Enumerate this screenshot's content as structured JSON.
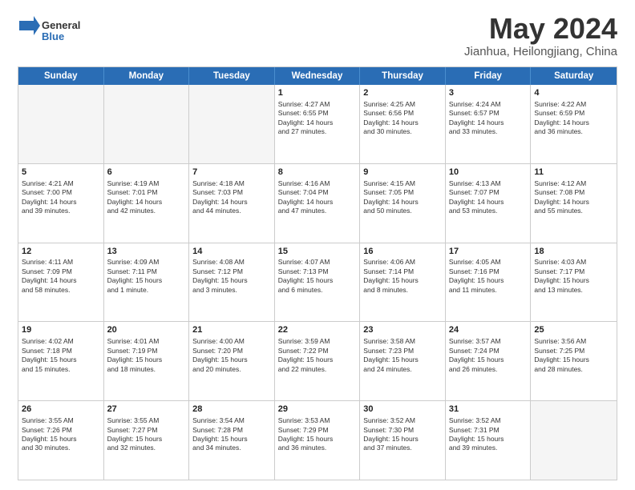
{
  "header": {
    "logo_general": "General",
    "logo_blue": "Blue",
    "month_title": "May 2024",
    "location": "Jianhua, Heilongjiang, China"
  },
  "weekdays": [
    "Sunday",
    "Monday",
    "Tuesday",
    "Wednesday",
    "Thursday",
    "Friday",
    "Saturday"
  ],
  "rows": [
    [
      {
        "day": "",
        "info": "",
        "empty": true
      },
      {
        "day": "",
        "info": "",
        "empty": true
      },
      {
        "day": "",
        "info": "",
        "empty": true
      },
      {
        "day": "1",
        "info": "Sunrise: 4:27 AM\nSunset: 6:55 PM\nDaylight: 14 hours\nand 27 minutes."
      },
      {
        "day": "2",
        "info": "Sunrise: 4:25 AM\nSunset: 6:56 PM\nDaylight: 14 hours\nand 30 minutes."
      },
      {
        "day": "3",
        "info": "Sunrise: 4:24 AM\nSunset: 6:57 PM\nDaylight: 14 hours\nand 33 minutes."
      },
      {
        "day": "4",
        "info": "Sunrise: 4:22 AM\nSunset: 6:59 PM\nDaylight: 14 hours\nand 36 minutes."
      }
    ],
    [
      {
        "day": "5",
        "info": "Sunrise: 4:21 AM\nSunset: 7:00 PM\nDaylight: 14 hours\nand 39 minutes."
      },
      {
        "day": "6",
        "info": "Sunrise: 4:19 AM\nSunset: 7:01 PM\nDaylight: 14 hours\nand 42 minutes."
      },
      {
        "day": "7",
        "info": "Sunrise: 4:18 AM\nSunset: 7:03 PM\nDaylight: 14 hours\nand 44 minutes."
      },
      {
        "day": "8",
        "info": "Sunrise: 4:16 AM\nSunset: 7:04 PM\nDaylight: 14 hours\nand 47 minutes."
      },
      {
        "day": "9",
        "info": "Sunrise: 4:15 AM\nSunset: 7:05 PM\nDaylight: 14 hours\nand 50 minutes."
      },
      {
        "day": "10",
        "info": "Sunrise: 4:13 AM\nSunset: 7:07 PM\nDaylight: 14 hours\nand 53 minutes."
      },
      {
        "day": "11",
        "info": "Sunrise: 4:12 AM\nSunset: 7:08 PM\nDaylight: 14 hours\nand 55 minutes."
      }
    ],
    [
      {
        "day": "12",
        "info": "Sunrise: 4:11 AM\nSunset: 7:09 PM\nDaylight: 14 hours\nand 58 minutes."
      },
      {
        "day": "13",
        "info": "Sunrise: 4:09 AM\nSunset: 7:11 PM\nDaylight: 15 hours\nand 1 minute."
      },
      {
        "day": "14",
        "info": "Sunrise: 4:08 AM\nSunset: 7:12 PM\nDaylight: 15 hours\nand 3 minutes."
      },
      {
        "day": "15",
        "info": "Sunrise: 4:07 AM\nSunset: 7:13 PM\nDaylight: 15 hours\nand 6 minutes."
      },
      {
        "day": "16",
        "info": "Sunrise: 4:06 AM\nSunset: 7:14 PM\nDaylight: 15 hours\nand 8 minutes."
      },
      {
        "day": "17",
        "info": "Sunrise: 4:05 AM\nSunset: 7:16 PM\nDaylight: 15 hours\nand 11 minutes."
      },
      {
        "day": "18",
        "info": "Sunrise: 4:03 AM\nSunset: 7:17 PM\nDaylight: 15 hours\nand 13 minutes."
      }
    ],
    [
      {
        "day": "19",
        "info": "Sunrise: 4:02 AM\nSunset: 7:18 PM\nDaylight: 15 hours\nand 15 minutes."
      },
      {
        "day": "20",
        "info": "Sunrise: 4:01 AM\nSunset: 7:19 PM\nDaylight: 15 hours\nand 18 minutes."
      },
      {
        "day": "21",
        "info": "Sunrise: 4:00 AM\nSunset: 7:20 PM\nDaylight: 15 hours\nand 20 minutes."
      },
      {
        "day": "22",
        "info": "Sunrise: 3:59 AM\nSunset: 7:22 PM\nDaylight: 15 hours\nand 22 minutes."
      },
      {
        "day": "23",
        "info": "Sunrise: 3:58 AM\nSunset: 7:23 PM\nDaylight: 15 hours\nand 24 minutes."
      },
      {
        "day": "24",
        "info": "Sunrise: 3:57 AM\nSunset: 7:24 PM\nDaylight: 15 hours\nand 26 minutes."
      },
      {
        "day": "25",
        "info": "Sunrise: 3:56 AM\nSunset: 7:25 PM\nDaylight: 15 hours\nand 28 minutes."
      }
    ],
    [
      {
        "day": "26",
        "info": "Sunrise: 3:55 AM\nSunset: 7:26 PM\nDaylight: 15 hours\nand 30 minutes."
      },
      {
        "day": "27",
        "info": "Sunrise: 3:55 AM\nSunset: 7:27 PM\nDaylight: 15 hours\nand 32 minutes."
      },
      {
        "day": "28",
        "info": "Sunrise: 3:54 AM\nSunset: 7:28 PM\nDaylight: 15 hours\nand 34 minutes."
      },
      {
        "day": "29",
        "info": "Sunrise: 3:53 AM\nSunset: 7:29 PM\nDaylight: 15 hours\nand 36 minutes."
      },
      {
        "day": "30",
        "info": "Sunrise: 3:52 AM\nSunset: 7:30 PM\nDaylight: 15 hours\nand 37 minutes."
      },
      {
        "day": "31",
        "info": "Sunrise: 3:52 AM\nSunset: 7:31 PM\nDaylight: 15 hours\nand 39 minutes."
      },
      {
        "day": "",
        "info": "",
        "empty": true
      }
    ]
  ]
}
